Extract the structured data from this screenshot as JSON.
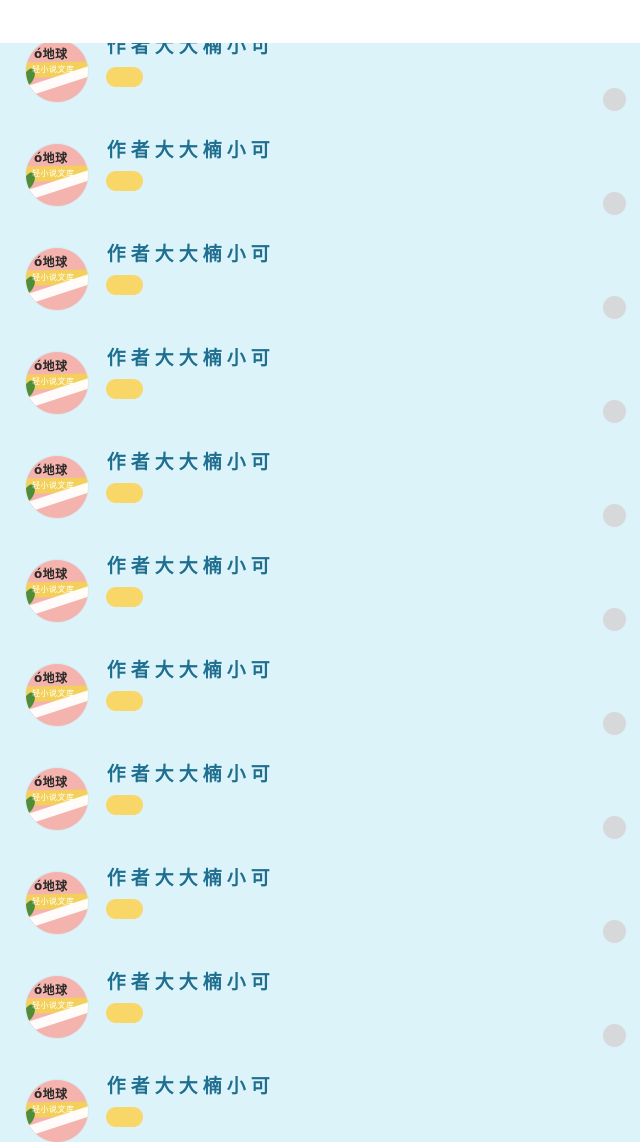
{
  "author_items": [
    {
      "name": "作者大大楠小可",
      "logo_text": "ó地球",
      "logo_sub": "轻小说文库"
    },
    {
      "name": "作者大大楠小可",
      "logo_text": "ó地球",
      "logo_sub": "轻小说文库"
    },
    {
      "name": "作者大大楠小可",
      "logo_text": "ó地球",
      "logo_sub": "轻小说文库"
    },
    {
      "name": "作者大大楠小可",
      "logo_text": "ó地球",
      "logo_sub": "轻小说文库"
    },
    {
      "name": "作者大大楠小可",
      "logo_text": "ó地球",
      "logo_sub": "轻小说文库"
    },
    {
      "name": "作者大大楠小可",
      "logo_text": "ó地球",
      "logo_sub": "轻小说文库"
    },
    {
      "name": "作者大大楠小可",
      "logo_text": "ó地球",
      "logo_sub": "轻小说文库"
    },
    {
      "name": "作者大大楠小可",
      "logo_text": "ó地球",
      "logo_sub": "轻小说文库"
    },
    {
      "name": "作者大大楠小可",
      "logo_text": "ó地球",
      "logo_sub": "轻小说文库"
    },
    {
      "name": "作者大大楠小可",
      "logo_text": "ó地球",
      "logo_sub": "轻小说文库"
    },
    {
      "name": "作者大大楠小可",
      "logo_text": "ó地球",
      "logo_sub": "轻小说文库"
    }
  ],
  "colors": {
    "background": "#ddf3fa",
    "name_text": "#1d6e8f",
    "tag": "#f8d768",
    "radio": "#d6d8d9",
    "avatar": "#f5b3ae"
  }
}
